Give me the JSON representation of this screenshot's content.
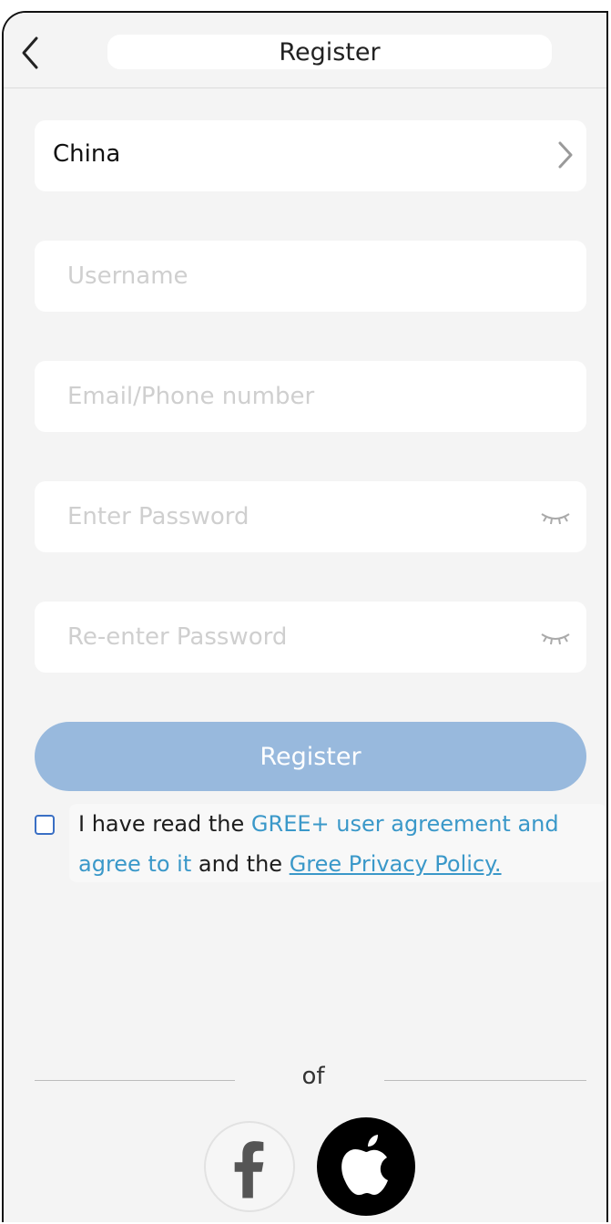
{
  "header": {
    "title": "Register"
  },
  "form": {
    "country": "China",
    "username_placeholder": "Username",
    "email_placeholder": "Email/Phone number",
    "password_placeholder": "Enter Password",
    "confirm_placeholder": "Re-enter Password"
  },
  "register_button": "Register",
  "agreement": {
    "prefix": "I have read the ",
    "user_agreement_link": "GREE+ user agreement and agree to it",
    "middle": " and the ",
    "privacy_link": "Gree Privacy Policy."
  },
  "divider_text": "of",
  "social": {
    "facebook_icon": "facebook-icon",
    "apple_icon": "apple-icon"
  },
  "colors": {
    "accent_button": "#98b9dd",
    "link": "#3a98c9",
    "checkbox": "#3a6fc4",
    "background": "#f4f4f4"
  }
}
